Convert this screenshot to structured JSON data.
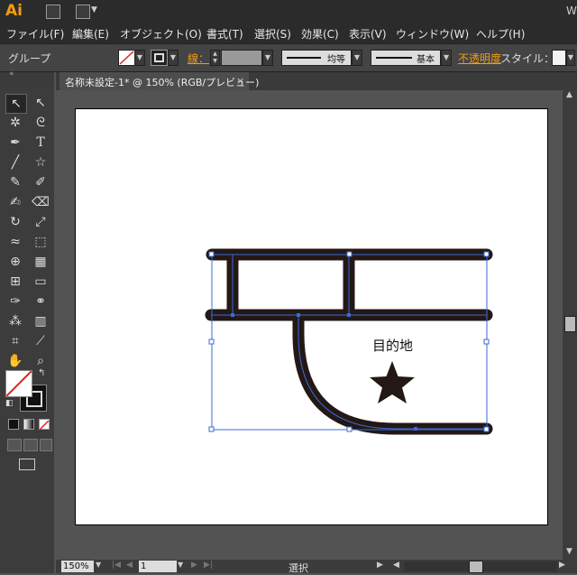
{
  "app": {
    "logo": "Ai"
  },
  "menu": [
    "ファイル(F)",
    "編集(E)",
    "オブジェクト(O)",
    "書式(T)",
    "選択(S)",
    "効果(C)",
    "表示(V)",
    "ウィンドウ(W)",
    "ヘルプ(H)"
  ],
  "control": {
    "selection_label": "グループ",
    "stroke_label": "線：",
    "profile_label": "均等",
    "brush_label": "基本",
    "opacity_label": "不透明度",
    "style_label": "スタイル：",
    "accent": "#f39c12"
  },
  "document": {
    "tab_title": "名称未設定-1* @ 150% (RGB/プレビュー)",
    "close": "×"
  },
  "artwork": {
    "label": "目的地",
    "stroke_color": "#231815",
    "selection_color": "#3a6bd6"
  },
  "status": {
    "zoom": "150%",
    "page": "1",
    "mode": "選択"
  }
}
